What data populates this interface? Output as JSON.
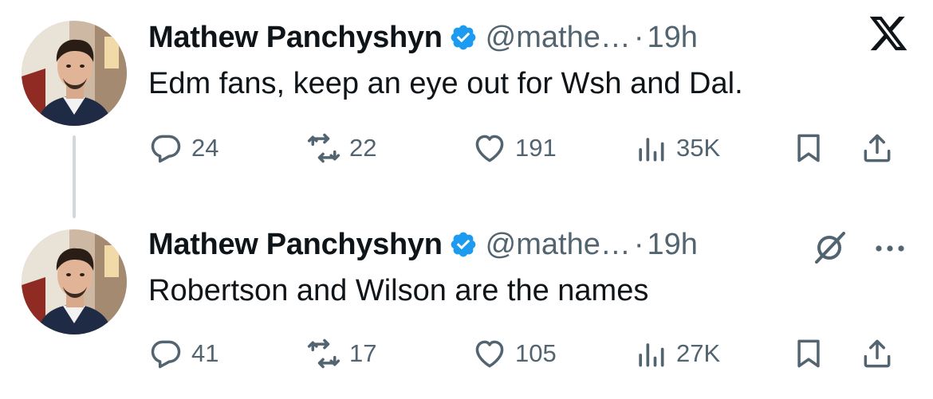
{
  "app": {
    "logo_icon": "x-logo-icon"
  },
  "tweets": [
    {
      "author": {
        "name": "Mathew Panchyshyn",
        "handle": "@mathe…",
        "verified_icon": "verified-badge-icon"
      },
      "separator": "·",
      "time": "19h",
      "text": "Edm fans, keep an eye out for Wsh and Dal.",
      "actions": {
        "replies": "24",
        "reposts": "22",
        "likes": "191",
        "views": "35K"
      },
      "header_icon": "x-logo-icon"
    },
    {
      "author": {
        "name": "Mathew Panchyshyn",
        "handle": "@mathe…",
        "verified_icon": "verified-badge-icon"
      },
      "separator": "·",
      "time": "19h",
      "text": "Robertson and Wilson are the names",
      "actions": {
        "replies": "41",
        "reposts": "17",
        "likes": "105",
        "views": "27K"
      },
      "header_icons": [
        "grok-icon",
        "more-icon"
      ]
    }
  ],
  "colors": {
    "verified": "#1d9bf0",
    "secondary_text": "#536471",
    "primary_text": "#0f1419",
    "thread_line": "#cfd9de"
  }
}
